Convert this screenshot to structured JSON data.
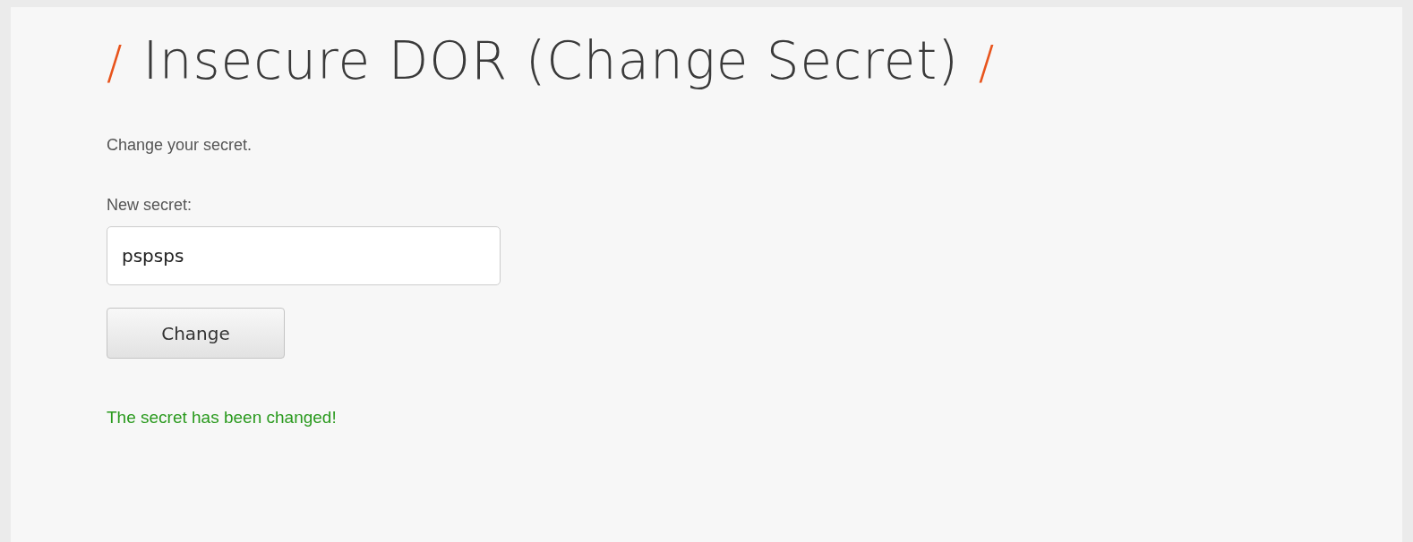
{
  "title": {
    "prefix": "/",
    "text": "Insecure DOR (Change Secret)",
    "suffix": "/"
  },
  "intro": "Change your secret.",
  "form": {
    "label": "New secret:",
    "value": "pspsps",
    "button": "Change"
  },
  "message": {
    "text": "The secret has been changed!",
    "kind": "success"
  }
}
